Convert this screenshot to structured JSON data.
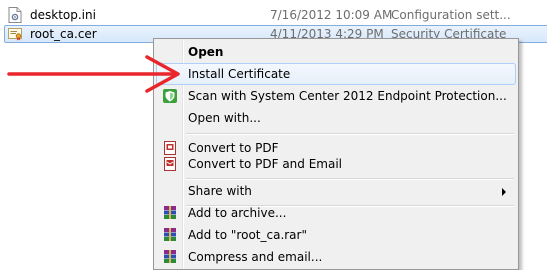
{
  "files": [
    {
      "name": "desktop.ini",
      "date": "7/16/2012 10:09 AM",
      "type": "Configuration sett...",
      "icon": "settings-file-icon"
    },
    {
      "name": "root_ca.cer",
      "date": "4/11/2013 4:29 PM",
      "type": "Security Certificate",
      "icon": "certificate-file-icon"
    }
  ],
  "context_menu": {
    "items": [
      {
        "label": "Open",
        "bold": true
      },
      {
        "label": "Install Certificate",
        "highlighted": true
      },
      {
        "label": "Scan with System Center 2012 Endpoint Protection...",
        "icon": "shield-icon"
      },
      {
        "label": "Open with..."
      },
      {
        "label": "Convert to PDF",
        "icon": "pdf-icon"
      },
      {
        "label": "Convert to PDF and Email",
        "icon": "pdf-email-icon"
      },
      {
        "label": "Share with",
        "submenu": true
      },
      {
        "label": "Add to archive...",
        "icon": "winrar-icon"
      },
      {
        "label": "Add to \"root_ca.rar\"",
        "icon": "winrar-icon"
      },
      {
        "label": "Compress and email...",
        "icon": "winrar-icon"
      }
    ]
  },
  "annotation": {
    "color": "#e8262b",
    "points_to": "Install Certificate"
  },
  "colors": {
    "shield": "#3ca13c",
    "arrow": "#e8262b",
    "selection_border": "#84acdd"
  }
}
